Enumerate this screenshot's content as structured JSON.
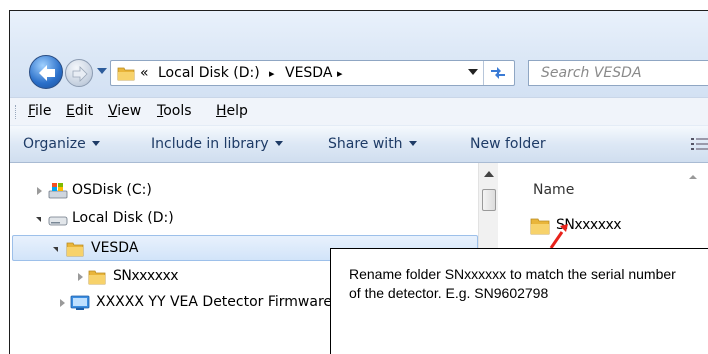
{
  "address_bar": {
    "overflow_glyph": "«",
    "crumbs": [
      "Local Disk (D:)",
      "VESDA"
    ],
    "separator": "▸",
    "search_placeholder": "Search VESDA"
  },
  "menu": {
    "items": [
      {
        "accel": "F",
        "rest": "ile"
      },
      {
        "accel": "E",
        "rest": "dit"
      },
      {
        "accel": "V",
        "rest": "iew"
      },
      {
        "accel": "T",
        "rest": "ools"
      },
      {
        "accel": "H",
        "rest": "elp"
      }
    ]
  },
  "toolbar": {
    "organize": "Organize",
    "include": "Include in library",
    "share": "Share with",
    "new_folder": "New folder"
  },
  "tree": {
    "items": [
      {
        "label": "OSDisk (C:)",
        "icon": "os-drive-icon",
        "state": "collapsed"
      },
      {
        "label": "Local Disk (D:)",
        "icon": "hard-drive-icon",
        "state": "expanded"
      },
      {
        "label": "VESDA",
        "icon": "folder-icon",
        "state": "expanded",
        "selected": true
      },
      {
        "label": "SNxxxxxx",
        "icon": "folder-icon",
        "state": "collapsed"
      },
      {
        "label": "XXXXX YY VEA Detector Firmware",
        "icon": "device-icon",
        "state": "collapsed"
      }
    ]
  },
  "file_list": {
    "column_name": "Name",
    "items": [
      {
        "label": "SNxxxxxx",
        "icon": "folder-icon"
      }
    ]
  },
  "callout": {
    "text": "Rename folder SNxxxxxx to match the serial number of the detector. E.g. SN9602798",
    "arrow_color": "#e8221b"
  },
  "colors": {
    "folder": "#e9b53a",
    "selection": "#d2e4f9",
    "command_text": "#1e3b66"
  }
}
